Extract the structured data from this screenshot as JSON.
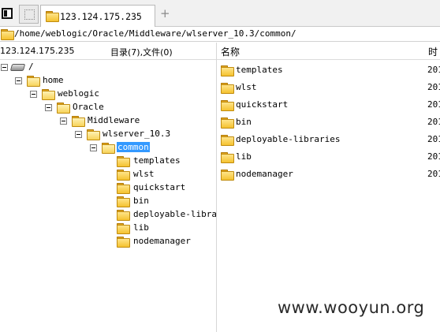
{
  "tabbar": {
    "active_tab": "123.124.175.235",
    "new_tab": "+"
  },
  "address": "/home/weblogic/Oracle/Middleware/wlserver_10.3/common/",
  "header": {
    "host": "123.124.175.235",
    "summary": "目录(7),文件(0)",
    "col_name": "名称",
    "col_time": "时"
  },
  "tree": {
    "root": "/",
    "home": "home",
    "weblogic": "weblogic",
    "oracle": "Oracle",
    "middleware": "Middleware",
    "wlserver": "wlserver_10.3",
    "common": "common",
    "children": [
      "templates",
      "wlst",
      "quickstart",
      "bin",
      "deployable-libraries",
      "lib",
      "nodemanager"
    ]
  },
  "list": {
    "rows": [
      {
        "name": "templates",
        "time": "201"
      },
      {
        "name": "wlst",
        "time": "201"
      },
      {
        "name": "quickstart",
        "time": "201"
      },
      {
        "name": "bin",
        "time": "201"
      },
      {
        "name": "deployable-libraries",
        "time": "201"
      },
      {
        "name": "lib",
        "time": "201"
      },
      {
        "name": "nodemanager",
        "time": "201"
      }
    ]
  },
  "watermark": "www.wooyun.org",
  "colors": {
    "selection": "#3399ff",
    "folder": "#f5c230"
  },
  "icons": [
    "toggle-view-icon",
    "tab-blank-icon",
    "folder-icon",
    "drive-icon",
    "collapse-icon"
  ]
}
